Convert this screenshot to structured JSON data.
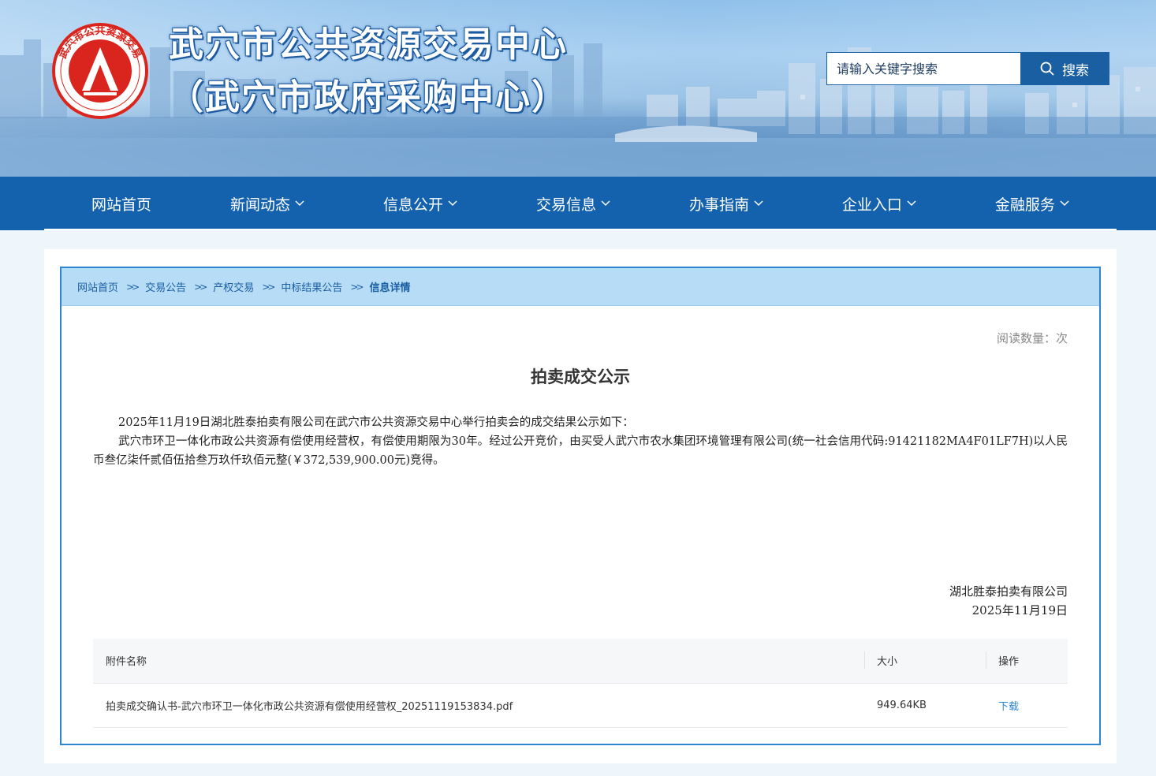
{
  "header": {
    "title": "武穴市公共资源交易中心",
    "subtitle": "（武穴市政府采购中心）",
    "logo_text": "武穴市公共资源交易",
    "logo_icon": "emblem-icon",
    "search": {
      "placeholder": "请输入关键字搜索",
      "value": "",
      "button_label": "搜索",
      "icon": "search-icon"
    }
  },
  "nav": {
    "items": [
      {
        "label": "网站首页",
        "has_dropdown": false
      },
      {
        "label": "新闻动态",
        "has_dropdown": true
      },
      {
        "label": "信息公开",
        "has_dropdown": true
      },
      {
        "label": "交易信息",
        "has_dropdown": true
      },
      {
        "label": "办事指南",
        "has_dropdown": true
      },
      {
        "label": "企业入口",
        "has_dropdown": true
      },
      {
        "label": "金融服务",
        "has_dropdown": true
      }
    ]
  },
  "breadcrumb": {
    "items": [
      "网站首页",
      "交易公告",
      "产权交易",
      "中标结果公告"
    ],
    "current": "信息详情",
    "separator": "》"
  },
  "article": {
    "read_count_label": "阅读数量：次",
    "title": "拍卖成交公示",
    "paragraphs": [
      "2025年11月19日湖北胜泰拍卖有限公司在武穴市公共资源交易中心举行拍卖会的成交结果公示如下：",
      "武穴市环卫一体化市政公共资源有偿使用经营权，有偿使用期限为30年。经过公开竞价，由买受人武穴市农水集团环境管理有限公司(统一社会信用代码:91421182MA4F01LF7H)以人民币叁亿柒仟贰佰伍拾叁万玖仟玖佰元整(￥372,539,900.00元)竞得。"
    ],
    "signature": {
      "company": "湖北胜泰拍卖有限公司",
      "date": "2025年11月19日"
    }
  },
  "attachments": {
    "headers": {
      "name": "附件名称",
      "size": "大小",
      "action": "操作"
    },
    "rows": [
      {
        "name": "拍卖成交确认书-武穴市环卫一体化市政公共资源有偿使用经营权_20251119153834.pdf",
        "size": "949.64KB",
        "action": "下载"
      }
    ]
  },
  "colors": {
    "nav_bg": "#1462ae",
    "accent": "#2d86d4",
    "breadcrumb_bg": "#b6dcf6",
    "logo_red": "#d9251d"
  }
}
